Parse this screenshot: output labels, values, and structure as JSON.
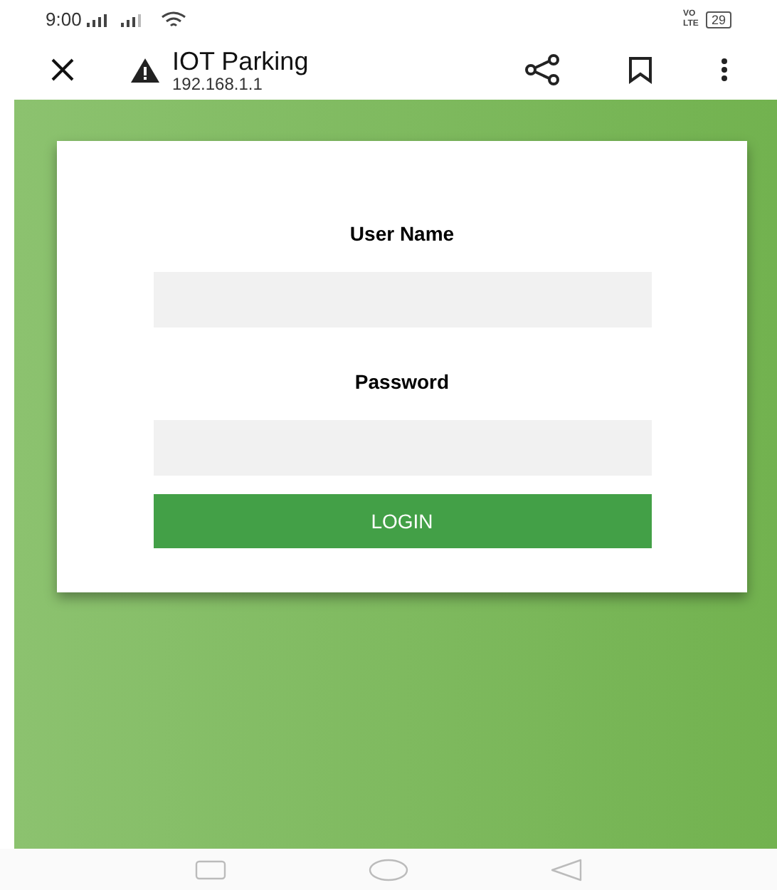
{
  "status_bar": {
    "time": "9:00",
    "network_badge": "VO LTE",
    "battery": "29"
  },
  "toolbar": {
    "title": "IOT Parking",
    "url": "192.168.1.1",
    "insecure": true
  },
  "form": {
    "fields": [
      {
        "label": "User Name"
      },
      {
        "label": "Password"
      }
    ],
    "button": "LOGIN"
  }
}
